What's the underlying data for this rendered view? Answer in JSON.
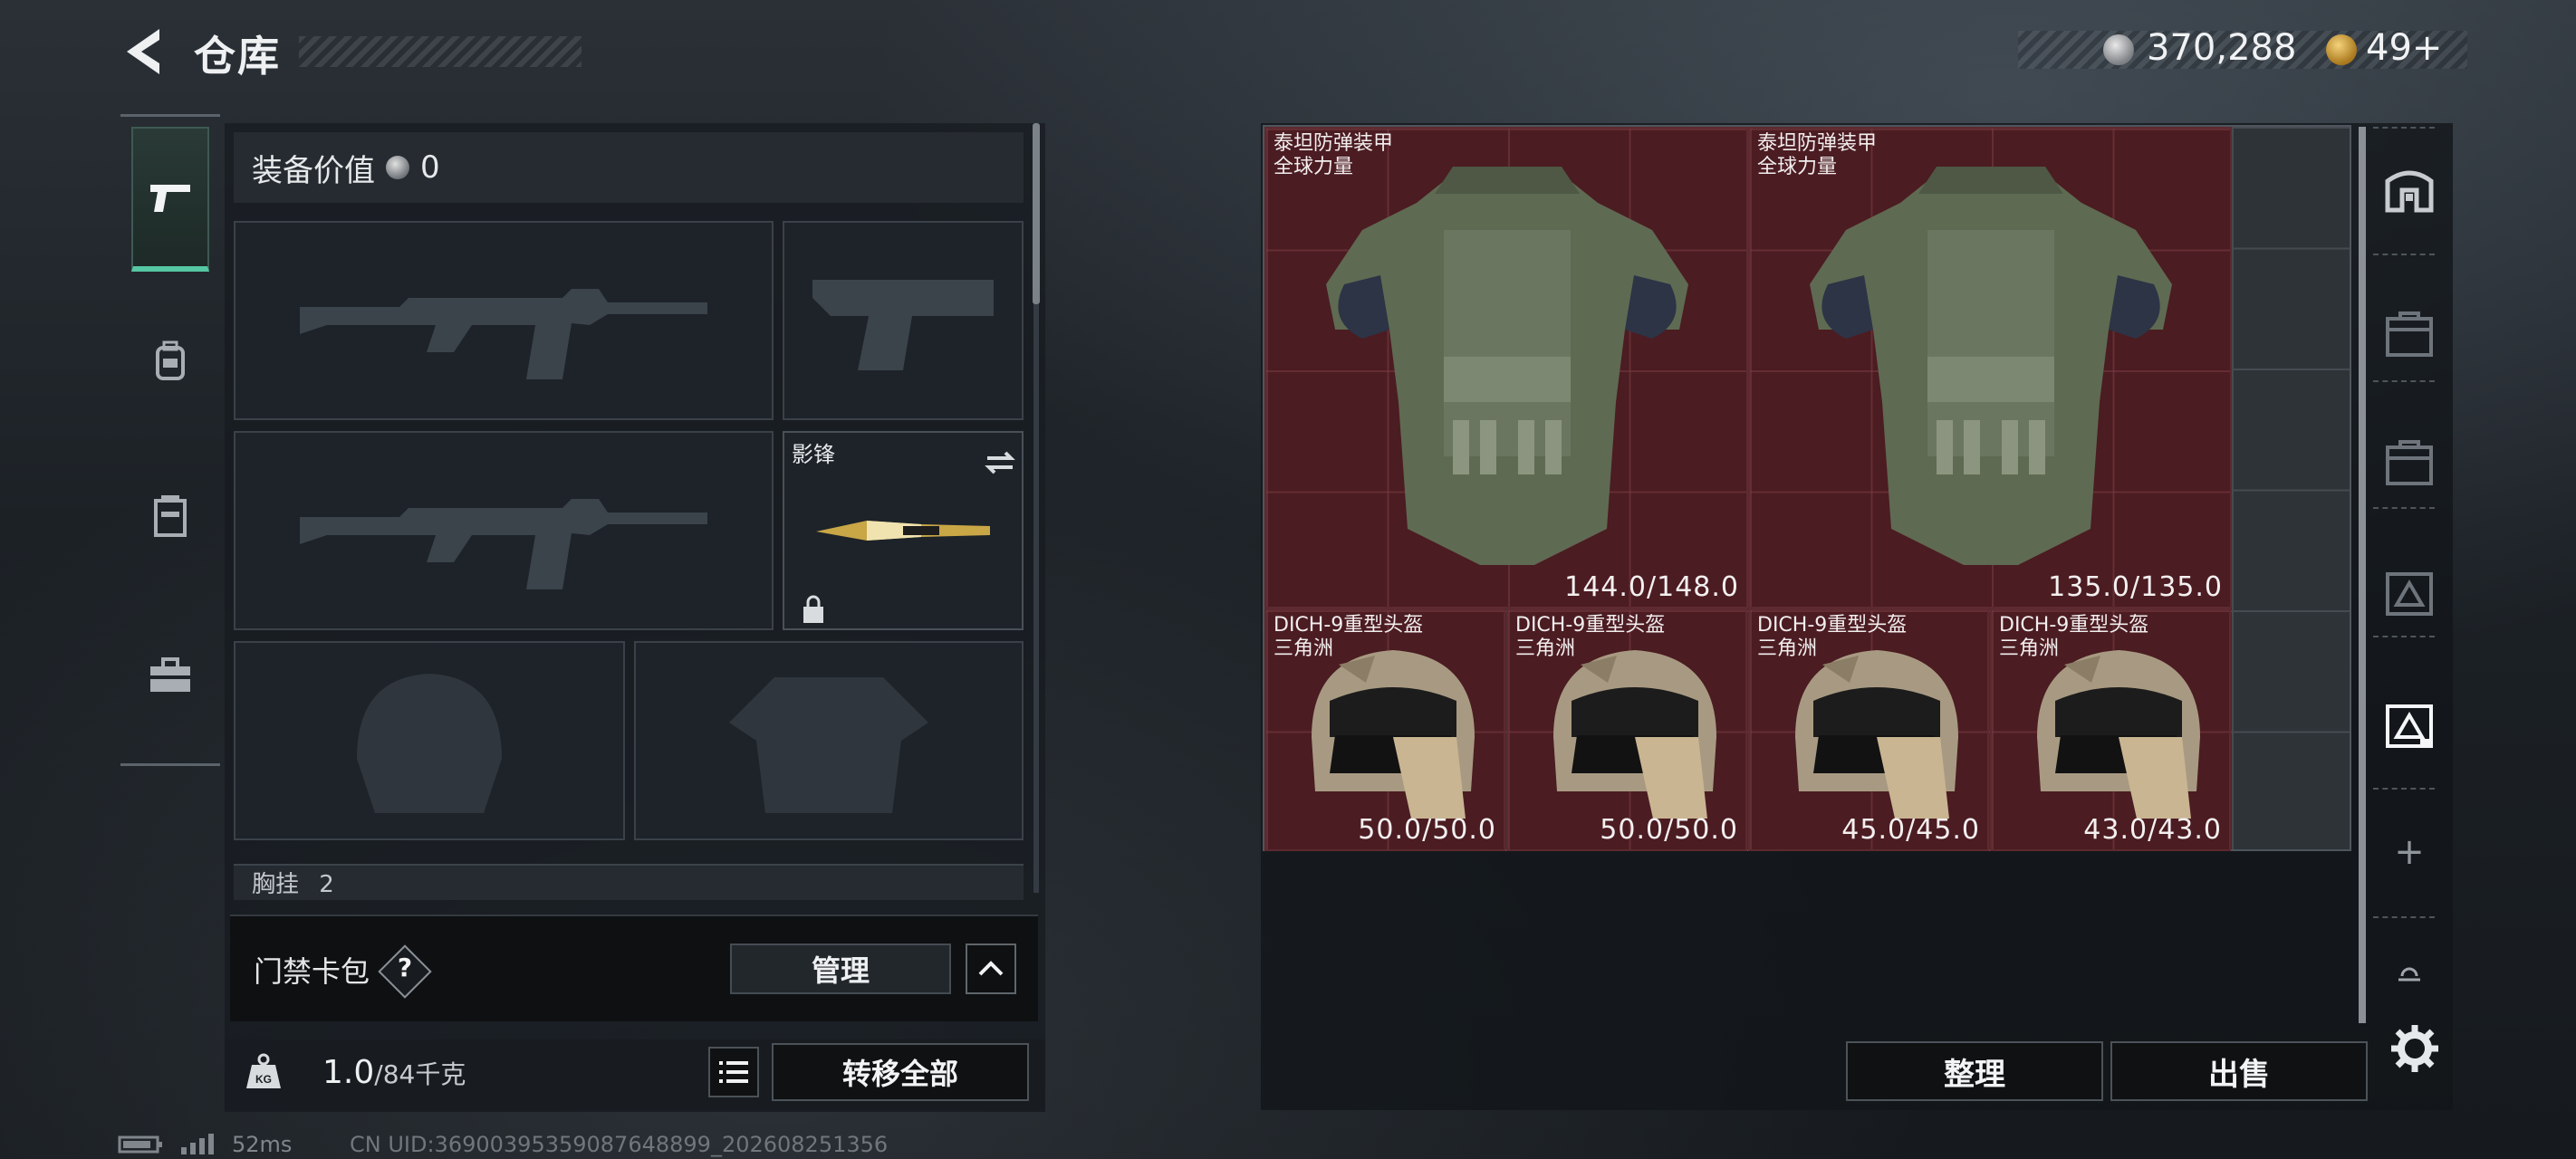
{
  "header": {
    "title": "仓库",
    "currency_silver": "370,288",
    "currency_gold": "49+"
  },
  "loadout": {
    "equip_value_label": "装备价值",
    "equip_value": "0",
    "knife_name": "影锋",
    "chest_rig_label": "胸挂",
    "chest_rig_count": "2",
    "card_pack_label": "门禁卡包",
    "help_glyph": "?",
    "manage_label": "管理",
    "weight_value": "1.0",
    "weight_cap": "/84千克",
    "transfer_all_label": "转移全部"
  },
  "categories": [
    {
      "icon": "pistol-icon",
      "active": true
    },
    {
      "icon": "backpack-icon",
      "active": false
    },
    {
      "icon": "vest-icon",
      "active": false
    },
    {
      "icon": "toolbox-icon",
      "active": false
    }
  ],
  "storage": {
    "items": [
      {
        "name": "泰坦防弹装甲",
        "sub": "全球力量",
        "durability": "144.0/148.0",
        "type": "armor"
      },
      {
        "name": "泰坦防弹装甲",
        "sub": "全球力量",
        "durability": "135.0/135.0",
        "type": "armor"
      },
      {
        "name": "DICH-9重型头盔",
        "sub": "三角洲",
        "durability": "50.0/50.0",
        "type": "helmet"
      },
      {
        "name": "DICH-9重型头盔",
        "sub": "三角洲",
        "durability": "50.0/50.0",
        "type": "helmet"
      },
      {
        "name": "DICH-9重型头盔",
        "sub": "三角洲",
        "durability": "45.0/45.0",
        "type": "helmet"
      },
      {
        "name": "DICH-9重型头盔",
        "sub": "三角洲",
        "durability": "43.0/43.0",
        "type": "helmet"
      }
    ],
    "sort_label": "整理",
    "sell_label": "出售",
    "add_glyph": "+"
  },
  "status": {
    "ping": "52ms",
    "uid": "CN UID:36900395359087648899_202608251356"
  },
  "colors": {
    "accent_green": "#56c7a3",
    "item_bg_red": "#4b1c22"
  }
}
